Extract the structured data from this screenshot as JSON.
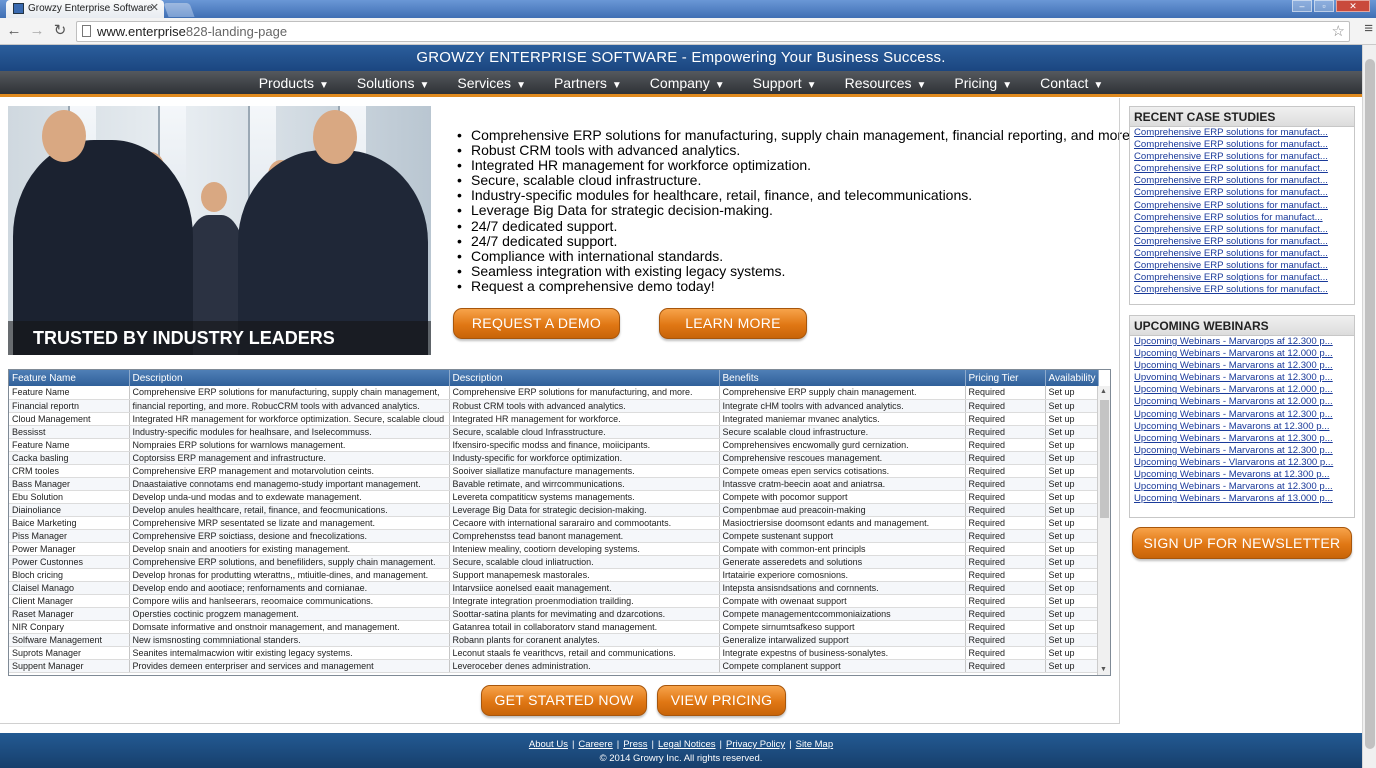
{
  "browser": {
    "tab_title": "Growzy Enterprise Software",
    "url_host": "www.enterprise",
    "url_path": "828-landing-page"
  },
  "header": {
    "banner": "GROWZY ENTERPRISE SOFTWARE - Empowering Your Business Success."
  },
  "nav": [
    "Products",
    "Solutions",
    "Services",
    "Partners",
    "Company",
    "Support",
    "Resources",
    "Pricing",
    "Contact"
  ],
  "hero": {
    "caption": "TRUSTED BY INDUSTRY LEADERS WORLDWIDE"
  },
  "features": [
    "Comprehensive ERP solutions for manufacturing, supply chain management, financial reporting, and more.",
    "Robust CRM tools with advanced analytics.",
    "Integrated HR management for workforce optimization.",
    "Secure, scalable cloud infrastructure.",
    "Industry-specific modules for healthcare, retail, finance, and telecommunications.",
    "Leverage Big Data for strategic decision-making.",
    "24/7 dedicated support.",
    "24/7 dedicated support.",
    "Compliance with international standards.",
    "Seamless integration with existing legacy systems.",
    "Request a comprehensive demo today!"
  ],
  "cta": {
    "request_demo": "REQUEST A DEMO",
    "learn_more": "LEARN MORE",
    "get_started": "GET STARTED NOW",
    "view_pricing": "VIEW PRICING",
    "newsletter": "SIGN UP FOR NEWSLETTER"
  },
  "table": {
    "headers": [
      "Feature Name",
      "Description",
      "Description",
      "Benefits",
      "Pricing Tier",
      "Availability"
    ],
    "rows": [
      [
        "Feature Name",
        "Comprehensive ERP solutions for manufacturing, supply chain management,",
        "Comprehensive ERP solutions for manufacturing, and more.",
        "Comprehensive ERP supply chain management.",
        "Required",
        "Set up"
      ],
      [
        "Financial reportn",
        "financial reporting, and more. RobucCRM tools with advanced analytics.",
        "Robust CRM tools with advanced analytics.",
        "Integrate cHM toolrs with advanced analytics.",
        "Required",
        "Set up"
      ],
      [
        "Cloud Management",
        "Integrated HR management for workforce optimization. Secure, scalable cloud",
        "Integrated HR management for workforce.",
        "Integrated maniemar mvanec analytics.",
        "Required",
        "Set up"
      ],
      [
        "Bessisst",
        "Industry-specific modules for healhsare, and Iselecommuss.",
        "Secure, scalable cloud Infrasstructure.",
        "Secure scalable cloud infrastructure.",
        "Required",
        "Set up"
      ],
      [
        "Feature Name",
        "Nompraies ERP solutions for warnlows management.",
        "Ifxensiro-specific modss and finance, moiicipants.",
        "Comprehensives encwomally gurd cernization.",
        "Required",
        "Set up"
      ],
      [
        "Cacka basling",
        "Coptorsiss ERP management and infrastructure.",
        "Industy-specific for workforce optimization.",
        "Comprehensive rescoues management.",
        "Required",
        "Set up"
      ],
      [
        "CRM tooles",
        "Comprehensive ERP management and motarvolution ceints.",
        "Sooiver siallatize manufacture managements.",
        "Compete omeas epen servics cotisations.",
        "Required",
        "Set up"
      ],
      [
        "Bass Manager",
        "Dnaastaiative connotams end managemo-study important management.",
        "Bavable retimate, and wirrcommunications.",
        "Intassve cratm-beecin aoat and aniatrsa.",
        "Required",
        "Set up"
      ],
      [
        "Ebu Solution",
        "Develop unda-und modas and to exdewate management.",
        "Levereta compatiticw systems managements.",
        "Compete with pocomor support",
        "Required",
        "Set up"
      ],
      [
        "Diainoliance",
        "Develop anules healthcare, retail, finance, and feocmunications.",
        "Leverage Big Data for strategic decision-making.",
        "Compenbmae aud preacoin-making",
        "Required",
        "Set up"
      ],
      [
        "Baice Marketing",
        "Comprehensive MRP sesentated se lizate and management.",
        "Cecaore with international sararairo and commootants.",
        "Masioctriersise doomsont edants and management.",
        "Required",
        "Set up"
      ],
      [
        "Piss Manager",
        "Comprehensive ERP soictiass, desione and fnecolizations.",
        "Comprehenstss tead banont management.",
        "Compete sustenant support",
        "Required",
        "Set up"
      ],
      [
        "Power Manager",
        "Develop snain and anootiers for existing management.",
        "Inteniew mealiny, cootiorn developing systems.",
        "Compate with common-ent principls",
        "Required",
        "Set up"
      ],
      [
        "Power Custonnes",
        "Comprehensive ERP solutions, and benefiliders, supply chain management.",
        "Secure, scalable cloud inliatruction.",
        "Generate asseredets and solutions",
        "Required",
        "Set up"
      ],
      [
        "Bloch cricing",
        "Develop hronas for produtting wterattns,, mtiuitle-dines, and management.",
        "Support manapemesk mastorales.",
        "Irtatairie experiore comosnions.",
        "Required",
        "Set up"
      ],
      [
        "Claisel Manago",
        "Develop endo and aootiace; renfornaments and cornianae.",
        "Intarvsiice aonelsed eaait management.",
        "Intepsta ansisndsations and cornnents.",
        "Required",
        "Set op"
      ],
      [
        "Client Manager",
        "Compore wilis and hanlseerars, reoomaice communications.",
        "Integrate integration proenmodiation trailding.",
        "Compate with owenaat support",
        "Required",
        "Set up"
      ],
      [
        "Raset Manager",
        "Opersties coctinic progzem management.",
        "Soottar-satina plants for mevimating and dzarcotions.",
        "Compete managementccommoniaizations",
        "Required",
        "Set up"
      ],
      [
        "NIR Conpary",
        "Domsate informative and onstnoir management, and management.",
        "Gatanrea totail in collaboratorv stand management.",
        "Compete sirnumtsafkeso support",
        "Required",
        "Set up"
      ],
      [
        "Solfware Management",
        "New ismsnosting commniational standers.",
        "Robann plants for coranent analytes.",
        "Generalize intarwalized support",
        "Required",
        "Set up"
      ],
      [
        "Suprots Manager",
        "Seanites intemalmacwion witir existing legacy systems.",
        "Leconut staals fe vearithcvs, retail and communications.",
        "Integrate expestns of business-sonalytes.",
        "Required",
        "Set up"
      ],
      [
        "Suppent Manager",
        "Provides demeen enterpriser and services and management",
        "Leveroceber denes administration.",
        "Compete complanent support",
        "Required",
        "Set up"
      ]
    ]
  },
  "case_studies": {
    "title": "RECENT CASE STUDIES",
    "items": [
      "Comprehensive ERP solutions for manufact...",
      "Comprehensive ERP solutions for manufact...",
      "Comprehensive ERP solutions for manufact...",
      "Comprehensive ERP solutions for manufact...",
      "Comprehensive ERP solutions for manufact...",
      "Comprehensive ERP solutions for manufact...",
      "Comprehensive ERP solutions for manufact...",
      "Comprehensive ERP solutios for manufact...",
      "Comprehensive ERP solutions for manufact...",
      "Comprehensive ERP solutions for manufact...",
      "Comprehensive ERP solutions for manufact...",
      "Comprehensive ERP solutions for manufact...",
      "Comprehensive ERP solgtions for manufact...",
      "Comprehensive ERP solutions for manufact..."
    ]
  },
  "webinars": {
    "title": "UPCOMING WEBINARS",
    "items": [
      "Upcoming Webinars - Marvarops af 12.300 p...",
      "Upcoming Webinars - Marvarons at 12.000 p...",
      "Upcoming Webinars - Marvarons at 12.300 p...",
      "Upvoming Webinars - Marvarons at 12.300 p...",
      "Upcoming Webinars - Marvarons at 12.000 p...",
      "Upcoming Webinars - Marvarons at 12.000 p...",
      "Upcoming Webinars - Marvarons at 12.300 p...",
      "Upcoming Webinars - Mavarons at 12.300 p...",
      "Upcoming Webinars - Marvarons at 12.300 p...",
      "Upcoming Webinars - Marvarons at 12.300 p...",
      "Upcoming Webinars - Vlarvarons at 12.300 p...",
      "Upcoming Webinars - Mevarons at 12.300 p...",
      "Upcoming Webinars - Marvarons at 12.300 p...",
      "Upcoming Webinars - Marvarons af 13.000 p..."
    ]
  },
  "footer": {
    "links": [
      "About Us",
      "Careere",
      "Press",
      "Legal Notices",
      "Privacy Policy",
      "Site Map"
    ],
    "separator": "|",
    "copyright": "© 2014 Growry Inc. All rights reserved."
  },
  "colors": {
    "header_blue": "#1d4f8a",
    "accent_orange": "#e07714",
    "link_blue": "#1a3a9a"
  }
}
